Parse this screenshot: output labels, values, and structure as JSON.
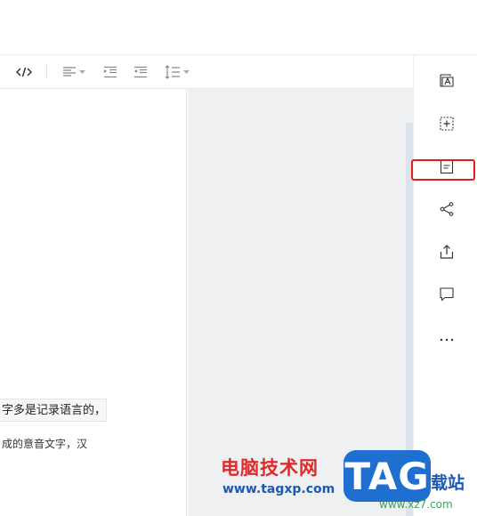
{
  "toolbar": {
    "items": [
      {
        "name": "code-icon"
      },
      {
        "name": "align-left-icon",
        "dropdown": true
      },
      {
        "name": "indent-increase-icon"
      },
      {
        "name": "indent-decrease-icon"
      },
      {
        "name": "line-spacing-icon",
        "dropdown": true
      }
    ]
  },
  "document": {
    "line1": "字多是记录语言的，",
    "line2": "成的意音文字，汉"
  },
  "sidebar": {
    "items": [
      {
        "name": "text-style-icon"
      },
      {
        "name": "insert-block-icon"
      },
      {
        "name": "outline-icon",
        "highlighted": true
      },
      {
        "name": "share-icon"
      },
      {
        "name": "export-icon"
      },
      {
        "name": "comment-icon"
      },
      {
        "name": "more-icon"
      }
    ],
    "highlight_color": "#e02020"
  },
  "watermark": {
    "brand_cn": "电脑技术网",
    "url": "www.tagxp.com",
    "logo": "TAG",
    "right_text": "载站",
    "small_url": "www.xz7.com"
  },
  "colors": {
    "canvas_bg": "#eff0f2",
    "scroll_track": "#dde3ec",
    "brand_red": "#e02a2a",
    "brand_blue": "#1e6fd0"
  }
}
